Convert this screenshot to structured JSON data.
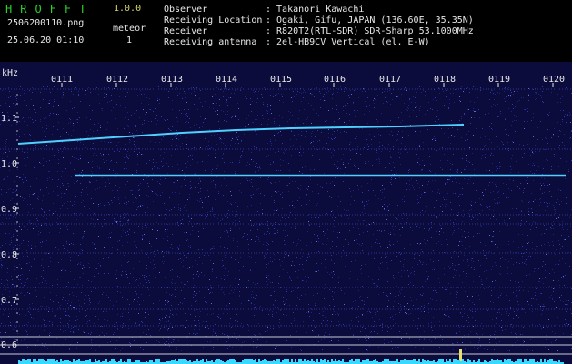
{
  "app": {
    "logo": "HROFFT",
    "version": "1.0.0",
    "filename": "2506200110.png",
    "datetime": "25.06.20 01:10",
    "counter_label": "meteor",
    "counter_value": "1"
  },
  "info": {
    "rows": [
      {
        "label": "Observer",
        "value": ": Takanori Kawachi"
      },
      {
        "label": "Receiving Location",
        "value": ": Ogaki, Gifu, JAPAN (136.60E, 35.35N)"
      },
      {
        "label": "Receiver",
        "value": ": R820T2(RTL-SDR) SDR-Sharp 53.1000MHz"
      },
      {
        "label": "Receiving antenna",
        "value": ": 2el-HB9CV Vertical (el. E-W)"
      }
    ]
  },
  "axis": {
    "y_unit": "kHz",
    "time_ticks": [
      "0111",
      "0112",
      "0113",
      "0114",
      "0115",
      "0116",
      "0117",
      "0118",
      "0119",
      "0120"
    ],
    "freq_ticks": [
      "1.1",
      "1.0",
      "0.9",
      "0.8",
      "0.7",
      "0.6"
    ]
  },
  "colors": {
    "background": "#0b0b3c",
    "noise_dot": "#2a3aa8",
    "header_text": "#e8e8e8",
    "logo": "#28d228",
    "version": "#d8d870",
    "trace": "#50d0ff",
    "noise_floor": "#38d8ff"
  }
}
